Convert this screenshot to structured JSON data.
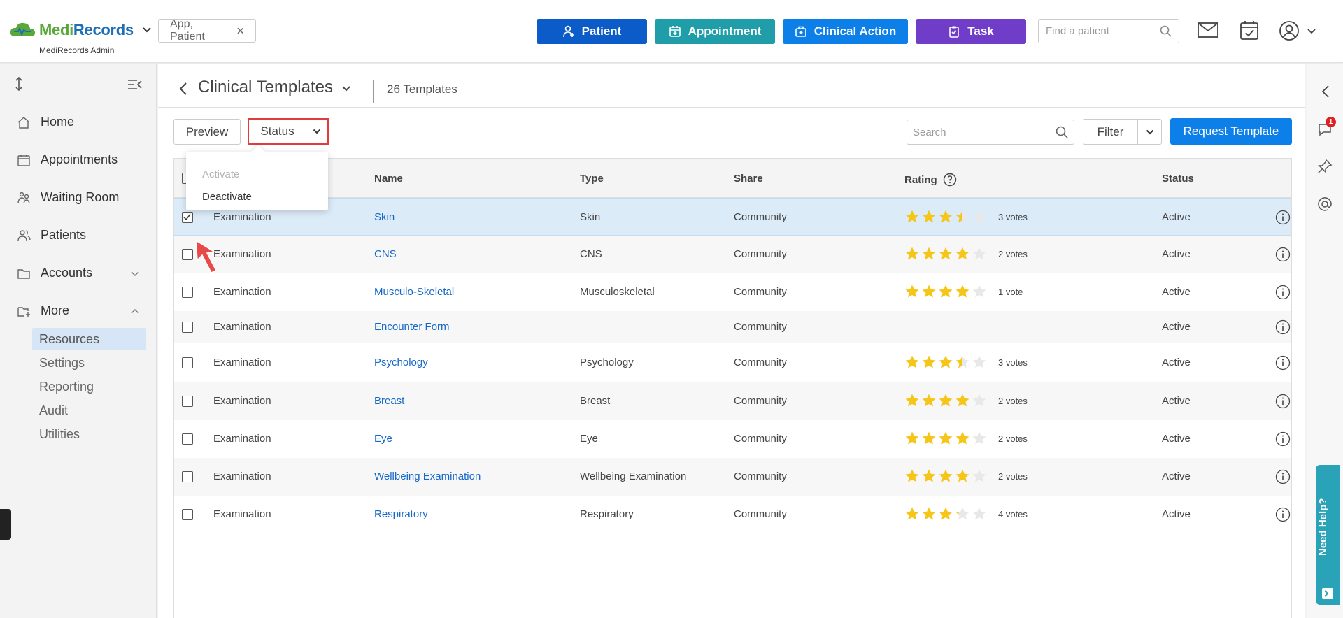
{
  "header": {
    "brand": {
      "part1": "Medi",
      "part2": "Records"
    },
    "brand_sub": "MediRecords Admin",
    "filter_chip": "App, Patient",
    "buttons": {
      "patient": "Patient",
      "appointment": "Appointment",
      "clinical_action": "Clinical Action",
      "task": "Task"
    },
    "find_patient_placeholder": "Find a patient"
  },
  "sidebar": {
    "items": [
      {
        "label": "Home"
      },
      {
        "label": "Appointments"
      },
      {
        "label": "Waiting Room"
      },
      {
        "label": "Patients"
      },
      {
        "label": "Accounts"
      },
      {
        "label": "More"
      }
    ],
    "sub_items": [
      {
        "label": "Resources",
        "active": true
      },
      {
        "label": "Settings"
      },
      {
        "label": "Reporting"
      },
      {
        "label": "Audit"
      },
      {
        "label": "Utilities"
      }
    ]
  },
  "page": {
    "title": "Clinical Templates",
    "count": "26 Templates"
  },
  "toolbar": {
    "preview": "Preview",
    "status": "Status",
    "search_placeholder": "Search",
    "filter": "Filter",
    "request": "Request Template"
  },
  "status_menu": {
    "activate": "Activate",
    "deactivate": "Deactivate"
  },
  "table": {
    "headers": {
      "name": "Name",
      "type": "Type",
      "share": "Share",
      "rating": "Rating",
      "status": "Status"
    },
    "rows": [
      {
        "category": "Examination",
        "name": "Skin",
        "type": "Skin",
        "share": "Community",
        "rating": 3.5,
        "votes": "3 votes",
        "status": "Active",
        "checked": true
      },
      {
        "category": "Examination",
        "name": "CNS",
        "type": "CNS",
        "share": "Community",
        "rating": 4,
        "votes": "2 votes",
        "status": "Active",
        "checked": false
      },
      {
        "category": "Examination",
        "name": "Musculo-Skeletal",
        "type": "Musculoskeletal",
        "share": "Community",
        "rating": 4,
        "votes": "1 vote",
        "status": "Active",
        "checked": false
      },
      {
        "category": "Examination",
        "name": "Encounter Form",
        "type": "",
        "share": "Community",
        "rating": null,
        "votes": "",
        "status": "Active",
        "checked": false
      },
      {
        "category": "Examination",
        "name": "Psychology",
        "type": "Psychology",
        "share": "Community",
        "rating": 3.5,
        "votes": "3 votes",
        "status": "Active",
        "checked": false
      },
      {
        "category": "Examination",
        "name": "Breast",
        "type": "Breast",
        "share": "Community",
        "rating": 4,
        "votes": "2 votes",
        "status": "Active",
        "checked": false
      },
      {
        "category": "Examination",
        "name": "Eye",
        "type": "Eye",
        "share": "Community",
        "rating": 4,
        "votes": "2 votes",
        "status": "Active",
        "checked": false
      },
      {
        "category": "Examination",
        "name": "Wellbeing Examination",
        "type": "Wellbeing Examination",
        "share": "Community",
        "rating": 4,
        "votes": "2 votes",
        "status": "Active",
        "checked": false
      },
      {
        "category": "Examination",
        "name": "Respiratory",
        "type": "Respiratory",
        "share": "Community",
        "rating": 3.2,
        "votes": "4 votes",
        "status": "Active",
        "checked": false
      }
    ]
  },
  "rail": {
    "notification_count": "1",
    "help": "Need Help?"
  },
  "colors": {
    "primary": "#0d7fe8",
    "patient": "#0b5cc8",
    "appointment": "#1f9eaa",
    "task": "#6f3dc8",
    "star": "#f5c518",
    "highlight": "#e23b3b"
  }
}
